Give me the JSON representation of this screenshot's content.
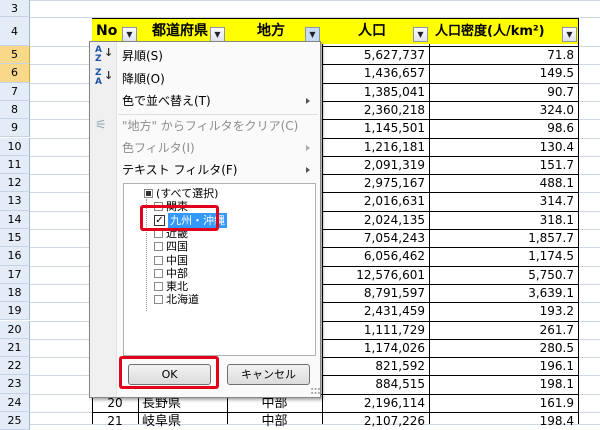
{
  "row_numbers": [
    "3",
    "4",
    "5",
    "6",
    "7",
    "8",
    "9",
    "10",
    "11",
    "12",
    "13",
    "14",
    "15",
    "16",
    "17",
    "18",
    "19",
    "20",
    "21",
    "22",
    "23",
    "24",
    "25"
  ],
  "selected_rows": [
    "5",
    "6"
  ],
  "headers": {
    "no": "No",
    "prefecture": "都道府県",
    "region": "地方",
    "population": "人口",
    "density": "人口密度(人/km²)"
  },
  "population_values": [
    "5,627,737",
    "1,436,657",
    "1,385,041",
    "2,360,218",
    "1,145,501",
    "1,216,181",
    "2,091,319",
    "2,975,167",
    "2,016,631",
    "2,024,135",
    "7,054,243",
    "6,056,462",
    "12,576,601",
    "8,791,597",
    "2,431,459",
    "1,111,729",
    "1,174,026",
    "821,592",
    "884,515",
    "2,196,114",
    "2,107,226"
  ],
  "density_values": [
    "71.8",
    "149.5",
    "90.7",
    "324.0",
    "98.6",
    "130.4",
    "151.7",
    "488.1",
    "314.7",
    "318.1",
    "1,857.7",
    "1,174.5",
    "5,750.7",
    "3,639.1",
    "193.2",
    "261.7",
    "280.5",
    "196.1",
    "198.1",
    "161.9",
    "198.4"
  ],
  "partial_rows": [
    {
      "no": "20",
      "prefecture": "長野県",
      "region": "中部"
    },
    {
      "no": "21",
      "prefecture": "岐阜県",
      "region": "中部"
    }
  ],
  "filter_menu": {
    "sort_asc": "昇順(S)",
    "sort_desc": "降順(O)",
    "sort_by_color": "色で並べ替え(T)",
    "clear_filter": "\"地方\" からフィルタをクリア(C)",
    "color_filter": "色フィルタ(I)",
    "text_filter": "テキスト フィルタ(F)",
    "list_items": [
      {
        "label": "(すべて選択)",
        "state": "partial"
      },
      {
        "label": "関東",
        "state": "off"
      },
      {
        "label": "九州・沖縄",
        "state": "on"
      },
      {
        "label": "近畿",
        "state": "off"
      },
      {
        "label": "四国",
        "state": "off"
      },
      {
        "label": "中国",
        "state": "off"
      },
      {
        "label": "中部",
        "state": "off"
      },
      {
        "label": "東北",
        "state": "off"
      },
      {
        "label": "北海道",
        "state": "off"
      }
    ],
    "ok_label": "OK",
    "cancel_label": "キャンセル"
  },
  "icons": {
    "sort_asc": "sort-ascending-icon",
    "sort_desc": "sort-descending-icon",
    "clear_filter": "clear-filter-icon",
    "dropdown": "dropdown-arrow-icon"
  },
  "colors": {
    "header_fill": "#ffff00",
    "highlight": "#e2001a",
    "selected_row_header": "#f8d98a",
    "list_selection": "#3399ff"
  }
}
